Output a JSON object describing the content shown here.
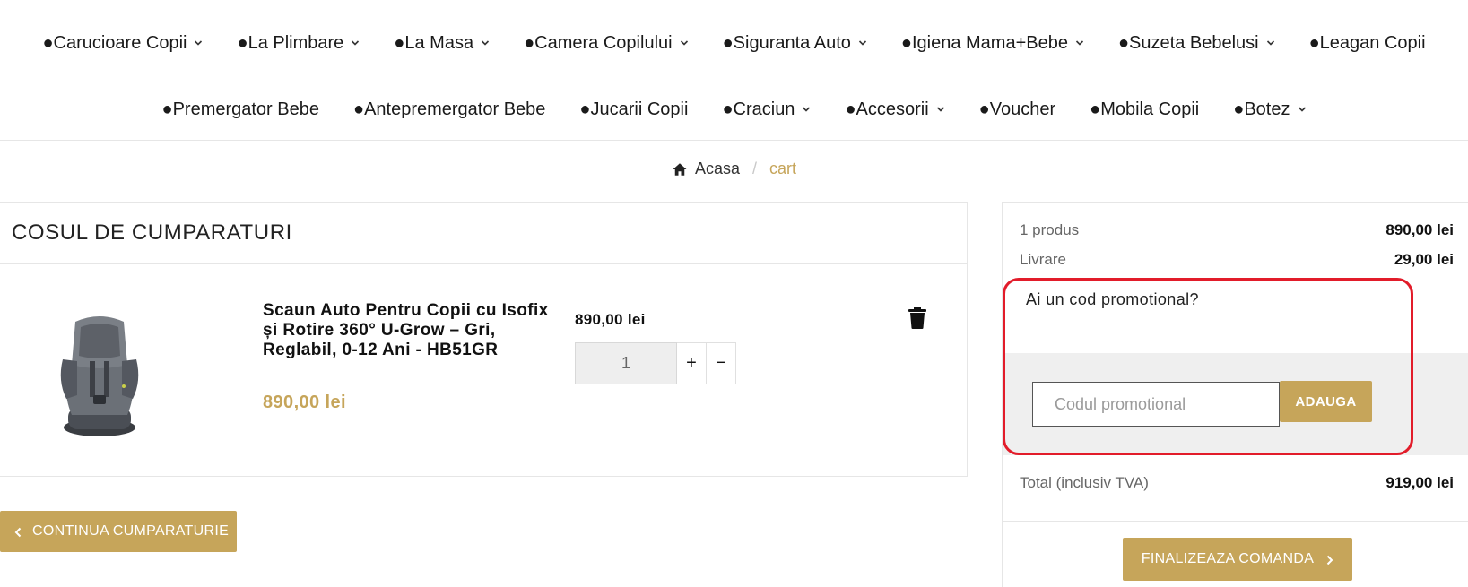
{
  "nav": {
    "row1": [
      {
        "label": "●Carucioare Copii",
        "dropdown": true
      },
      {
        "label": "●La Plimbare",
        "dropdown": true
      },
      {
        "label": "●La Masa",
        "dropdown": true
      },
      {
        "label": "●Camera Copilului",
        "dropdown": true
      },
      {
        "label": "●Siguranta Auto",
        "dropdown": true
      },
      {
        "label": "●Igiena Mama+Bebe",
        "dropdown": true
      },
      {
        "label": "●Suzeta Bebelusi",
        "dropdown": true
      },
      {
        "label": "●Leagan Copii",
        "dropdown": false
      }
    ],
    "row2": [
      {
        "label": "●Premergator Bebe",
        "dropdown": false
      },
      {
        "label": "●Antepremergator Bebe",
        "dropdown": false
      },
      {
        "label": "●Jucarii Copii",
        "dropdown": false
      },
      {
        "label": "●Craciun",
        "dropdown": true
      },
      {
        "label": "●Accesorii",
        "dropdown": true
      },
      {
        "label": "●Voucher",
        "dropdown": false
      },
      {
        "label": "●Mobila Copii",
        "dropdown": false
      },
      {
        "label": "●Botez",
        "dropdown": true
      }
    ]
  },
  "breadcrumb": {
    "home": "Acasa",
    "separator": "/",
    "current": "cart"
  },
  "cart": {
    "title": "COSUL DE CUMPARATURI",
    "item": {
      "name": "Scaun Auto Pentru Copii cu Isofix și Rotire 360° U-Grow – Gri, Reglabil, 0-12 Ani - HB51GR",
      "price": "890,00 lei",
      "unit_price": "890,00 lei",
      "quantity": "1",
      "plus": "+",
      "minus": "−"
    },
    "continue_label": "CONTINUA CUMPARATURIE"
  },
  "summary": {
    "products_label": "1 produs",
    "products_value": "890,00 lei",
    "shipping_label": "Livrare",
    "shipping_value": "29,00 lei",
    "promo_question": "Ai un cod promotional?",
    "promo_placeholder": "Codul promotional",
    "promo_button": "ADAUGA",
    "total_label": "Total (inclusiv TVA)",
    "total_value": "919,00 lei",
    "checkout_label": "FINALIZEAZA COMANDA"
  },
  "colors": {
    "accent": "#c6a55a",
    "highlight": "#e21c2a"
  }
}
